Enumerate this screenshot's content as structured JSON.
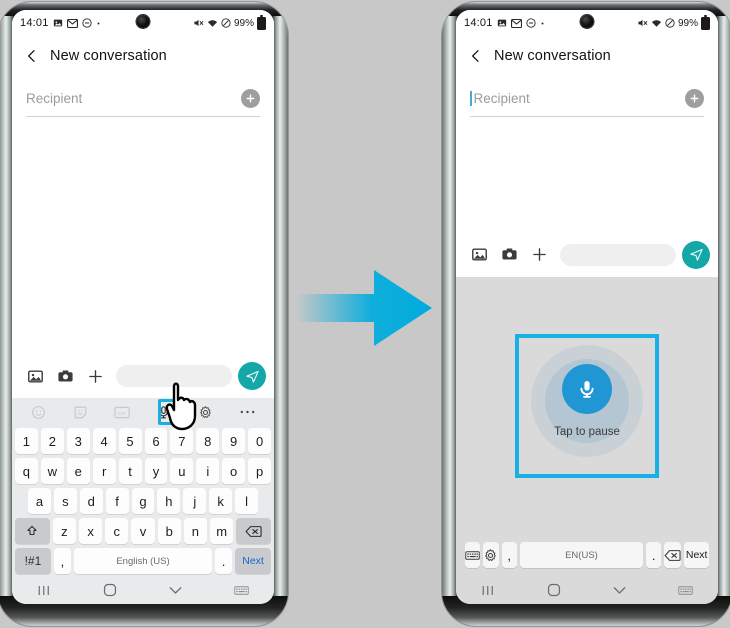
{
  "meta": {
    "background_color": "#c8c8c8",
    "accent_highlight": "#18b0e4",
    "send_button_color": "#14a7a7",
    "mic_button_color": "#2196d4"
  },
  "arrow": {
    "name": "transition-arrow",
    "color": "#00acdd"
  },
  "status_bar": {
    "time": "14:01",
    "left_icons": [
      "image-icon",
      "mail-icon",
      "do-not-disturb-icon",
      "dot-icon"
    ],
    "right_icons": [
      "mute-icon",
      "wifi-icon",
      "do-not-disturb-icon"
    ],
    "battery_percent": "99%",
    "battery_icon": "battery-icon"
  },
  "app_bar": {
    "back_icon": "back-chevron-icon",
    "title": "New conversation"
  },
  "recipient": {
    "placeholder": "Recipient",
    "value": "",
    "add_icon": "add-contact-plus-icon"
  },
  "compose": {
    "image_icon": "gallery-icon",
    "camera_icon": "camera-icon",
    "plus_icon": "plus-icon",
    "field_value": "",
    "field_placeholder": "",
    "send_icon": "send-icon"
  },
  "keyboard_left": {
    "toolbar": [
      {
        "name": "emoji-icon",
        "label": "Emoji",
        "highlighted": false
      },
      {
        "name": "sticker-icon",
        "label": "Sticker",
        "highlighted": false
      },
      {
        "name": "gif-icon",
        "label": "GIF",
        "highlighted": false
      },
      {
        "name": "microphone-icon",
        "label": "Voice input",
        "highlighted": true
      },
      {
        "name": "settings-gear-icon",
        "label": "Settings",
        "highlighted": false
      },
      {
        "name": "more-options-icon",
        "label": "More",
        "highlighted": false
      }
    ],
    "row_numbers": [
      "1",
      "2",
      "3",
      "4",
      "5",
      "6",
      "7",
      "8",
      "9",
      "0"
    ],
    "row_top": [
      "q",
      "w",
      "e",
      "r",
      "t",
      "y",
      "u",
      "i",
      "o",
      "p"
    ],
    "row_home": [
      "a",
      "s",
      "d",
      "f",
      "g",
      "h",
      "j",
      "k",
      "l"
    ],
    "row_bottom": [
      "z",
      "x",
      "c",
      "v",
      "b",
      "n",
      "m"
    ],
    "shift_icon": "shift-arrow-icon",
    "backspace_icon": "backspace-icon",
    "symbols_key": "!#1",
    "comma_key": ",",
    "space_key": "English (US)",
    "period_key": ".",
    "next_key": "Next"
  },
  "voice_panel": {
    "mic_icon": "microphone-icon",
    "label": "Tap to pause",
    "highlighted": true
  },
  "keyboard_right": {
    "keyboard_icon": "keyboard-icon",
    "settings_icon": "settings-gear-icon",
    "comma_key": ",",
    "space_key": "EN(US)",
    "period_key": ".",
    "backspace_icon": "backspace-icon",
    "next_key": "Next"
  },
  "nav_bar": {
    "recents_icon": "recents-icon",
    "home_icon": "home-icon",
    "collapse_icon": "collapse-chevron-icon",
    "keyboard_switch_icon": "keyboard-switch-icon"
  }
}
